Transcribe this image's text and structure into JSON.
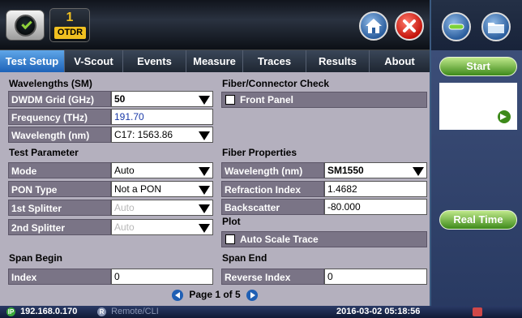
{
  "header": {
    "otdr_number": "1",
    "otdr_label": "OTDR"
  },
  "tabs": [
    {
      "label": "Test Setup",
      "active": true
    },
    {
      "label": "V-Scout",
      "active": false
    },
    {
      "label": "Events",
      "active": false
    },
    {
      "label": "Measure",
      "active": false
    },
    {
      "label": "Traces",
      "active": false
    },
    {
      "label": "Results",
      "active": false
    },
    {
      "label": "About",
      "active": false
    }
  ],
  "wavelengths": {
    "title": "Wavelengths (SM)",
    "dwdm_label": "DWDM Grid (GHz)",
    "dwdm_value": "50",
    "freq_label": "Frequency (THz)",
    "freq_value": "191.70",
    "wl_label": "Wavelength (nm)",
    "wl_value": "C17: 1563.86"
  },
  "test_parameter": {
    "title": "Test Parameter",
    "mode_label": "Mode",
    "mode_value": "Auto",
    "pon_label": "PON Type",
    "pon_value": "Not a PON",
    "splitter1_label": "1st Splitter",
    "splitter1_value": "Auto",
    "splitter2_label": "2nd Splitter",
    "splitter2_value": "Auto"
  },
  "span_begin": {
    "title": "Span Begin",
    "index_label": "Index",
    "index_value": "0"
  },
  "fiber_check": {
    "title": "Fiber/Connector Check",
    "front_panel_label": "Front Panel"
  },
  "fiber_properties": {
    "title": "Fiber Properties",
    "wl_label": "Wavelength (nm)",
    "wl_value": "SM1550",
    "ri_label": "Refraction Index",
    "ri_value": "1.4682",
    "bs_label": "Backscatter",
    "bs_value": "-80.000"
  },
  "plot": {
    "title": "Plot",
    "autoscale_label": "Auto Scale Trace"
  },
  "span_end": {
    "title": "Span End",
    "rindex_label": "Reverse Index",
    "rindex_value": "0"
  },
  "pager": {
    "text": "Page 1 of 5"
  },
  "side": {
    "start_label": "Start",
    "realtime_label": "Real Time"
  },
  "status": {
    "ip_badge": "IP",
    "ip": "192.168.0.170",
    "remote_badge": "R",
    "remote": "Remote/CLI",
    "datetime": "2016-03-02  05:18:56"
  },
  "colors": {
    "tab_active": "#1d62b8",
    "panel_bg": "#b4b0be",
    "label_bg": "#7a7486",
    "side_button": "#3d8a1a",
    "value_blue": "#1a3aa8"
  }
}
